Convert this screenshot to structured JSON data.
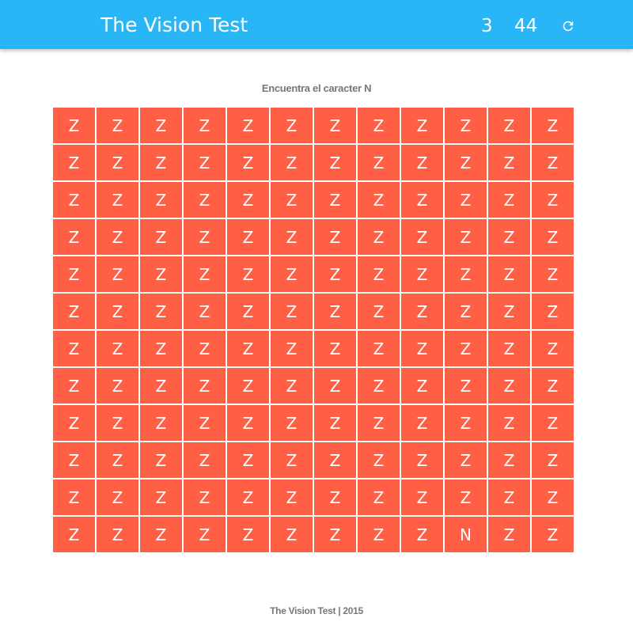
{
  "header": {
    "title": "The Vision Test",
    "level": "3",
    "timer": "44",
    "refresh_icon": "refresh-icon",
    "background_color": "#29b6f6"
  },
  "instruction": "Encuentra el caracter N",
  "grid": {
    "cell_color": "#ff5f45",
    "rows": [
      [
        "Z",
        "Z",
        "Z",
        "Z",
        "Z",
        "Z",
        "Z",
        "Z",
        "Z",
        "Z",
        "Z",
        "Z"
      ],
      [
        "Z",
        "Z",
        "Z",
        "Z",
        "Z",
        "Z",
        "Z",
        "Z",
        "Z",
        "Z",
        "Z",
        "Z"
      ],
      [
        "Z",
        "Z",
        "Z",
        "Z",
        "Z",
        "Z",
        "Z",
        "Z",
        "Z",
        "Z",
        "Z",
        "Z"
      ],
      [
        "Z",
        "Z",
        "Z",
        "Z",
        "Z",
        "Z",
        "Z",
        "Z",
        "Z",
        "Z",
        "Z",
        "Z"
      ],
      [
        "Z",
        "Z",
        "Z",
        "Z",
        "Z",
        "Z",
        "Z",
        "Z",
        "Z",
        "Z",
        "Z",
        "Z"
      ],
      [
        "Z",
        "Z",
        "Z",
        "Z",
        "Z",
        "Z",
        "Z",
        "Z",
        "Z",
        "Z",
        "Z",
        "Z"
      ],
      [
        "Z",
        "Z",
        "Z",
        "Z",
        "Z",
        "Z",
        "Z",
        "Z",
        "Z",
        "Z",
        "Z",
        "Z"
      ],
      [
        "Z",
        "Z",
        "Z",
        "Z",
        "Z",
        "Z",
        "Z",
        "Z",
        "Z",
        "Z",
        "Z",
        "Z"
      ],
      [
        "Z",
        "Z",
        "Z",
        "Z",
        "Z",
        "Z",
        "Z",
        "Z",
        "Z",
        "Z",
        "Z",
        "Z"
      ],
      [
        "Z",
        "Z",
        "Z",
        "Z",
        "Z",
        "Z",
        "Z",
        "Z",
        "Z",
        "Z",
        "Z",
        "Z"
      ],
      [
        "Z",
        "Z",
        "Z",
        "Z",
        "Z",
        "Z",
        "Z",
        "Z",
        "Z",
        "Z",
        "Z",
        "Z"
      ],
      [
        "Z",
        "Z",
        "Z",
        "Z",
        "Z",
        "Z",
        "Z",
        "Z",
        "Z",
        "N",
        "Z",
        "Z"
      ]
    ]
  },
  "footer": "The Vision Test | 2015"
}
